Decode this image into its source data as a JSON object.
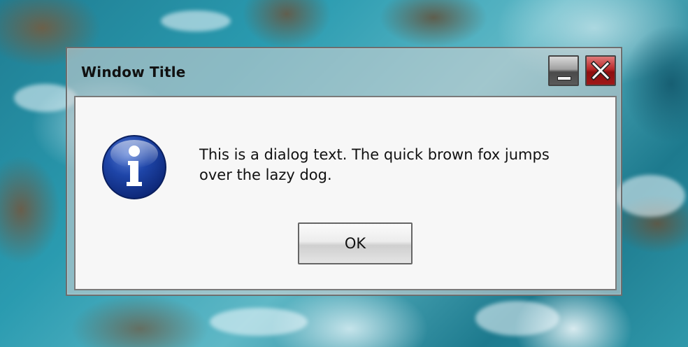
{
  "window": {
    "title": "Window Title",
    "minimize_icon": "minimize-icon",
    "close_icon": "close-icon"
  },
  "dialog": {
    "icon": "info-icon",
    "message": "This is a dialog text. The quick brown fox jumps over the lazy dog.",
    "ok_label": "OK"
  },
  "colors": {
    "close_button": "#b82828",
    "info_icon": "#1a3d9c"
  }
}
